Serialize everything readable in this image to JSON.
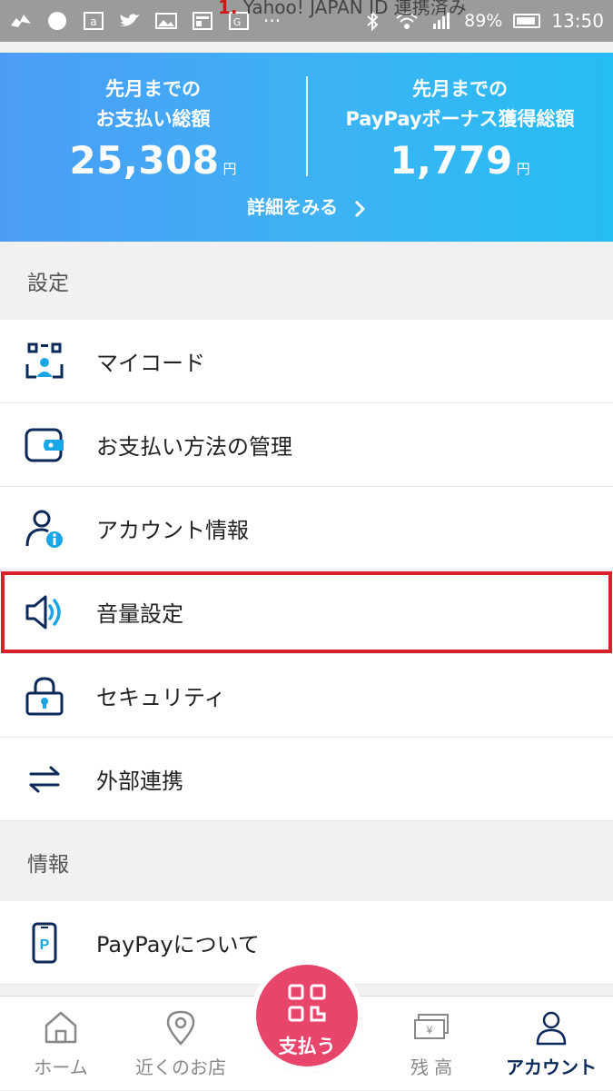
{
  "status_bar": {
    "notification_text": "Yahoo! JAPAN ID 連携済み",
    "battery": "89%",
    "time": "13:50"
  },
  "summary": {
    "left_label_1": "先月までの",
    "left_label_2": "お支払い総額",
    "left_amount": "25,308",
    "left_unit": "円",
    "right_label_1": "先月までの",
    "right_label_2": "PayPayボーナス獲得総額",
    "right_amount": "1,779",
    "right_unit": "円",
    "detail_link": "詳細をみる"
  },
  "settings": {
    "header": "設定",
    "items": [
      {
        "label": "マイコード",
        "icon": "qr-code-icon"
      },
      {
        "label": "お支払い方法の管理",
        "icon": "wallet-icon"
      },
      {
        "label": "アカウント情報",
        "icon": "user-info-icon"
      },
      {
        "label": "音量設定",
        "icon": "speaker-icon"
      },
      {
        "label": "セキュリティ",
        "icon": "lock-icon"
      },
      {
        "label": "外部連携",
        "icon": "swap-arrows-icon"
      }
    ]
  },
  "info": {
    "header": "情報",
    "items": [
      {
        "label": "PayPayについて",
        "icon": "phone-icon"
      }
    ]
  },
  "bottom_nav": {
    "home": "ホーム",
    "nearby": "近くのお店",
    "pay": "支払う",
    "balance": "残 高",
    "account": "アカウント"
  },
  "colors": {
    "accent": "#0b2a5a",
    "icon_blue": "#1aa5e6",
    "pay_pink": "#e8456a",
    "highlight_red": "#d8202a"
  }
}
